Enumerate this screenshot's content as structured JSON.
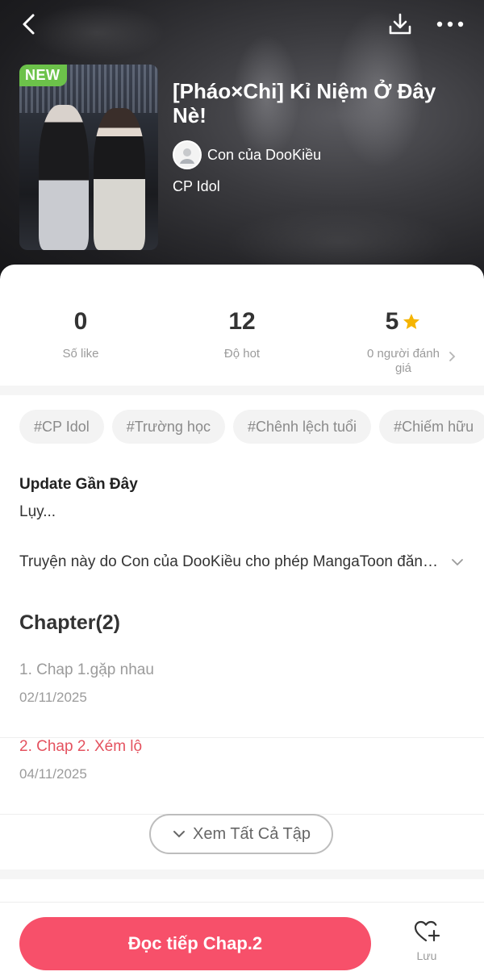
{
  "header": {
    "back_icon": "chevron-left-icon",
    "download_icon": "download-icon",
    "more_icon": "more-horizontal-icon"
  },
  "comic": {
    "badge": "NEW",
    "title": "[Pháo×Chi] Kỉ Niệm Ở Đây Nè!",
    "author": "Con của DooKiều",
    "category": "CP Idol"
  },
  "stats": {
    "likes_value": "0",
    "likes_label": "Số like",
    "hot_value": "12",
    "hot_label": "Độ hot",
    "rating_value": "5",
    "rating_label": "0 người đánh giá",
    "accent_star": "#f5b400"
  },
  "tags": [
    "#CP Idol",
    "#Trường học",
    "#Chênh lệch tuổi",
    "#Chiếm hữu"
  ],
  "update": {
    "title": "Update Gần Đây",
    "text": "Lụy..."
  },
  "description": "Truyện này do Con của DooKiều cho phép MangaToon đăng tải",
  "chapters": {
    "heading": "Chapter(2)",
    "items": [
      {
        "title": "1. Chap 1.gặp nhau",
        "date": "02/11/2025",
        "state": "read"
      },
      {
        "title": "2. Chap 2. Xém lộ",
        "date": "04/11/2025",
        "state": "current"
      }
    ],
    "see_all": "Xem Tất Cả Tập"
  },
  "bottom": {
    "read_button": "Đọc tiếp Chap.2",
    "save_label": "Lưu",
    "accent": "#f7506a"
  }
}
